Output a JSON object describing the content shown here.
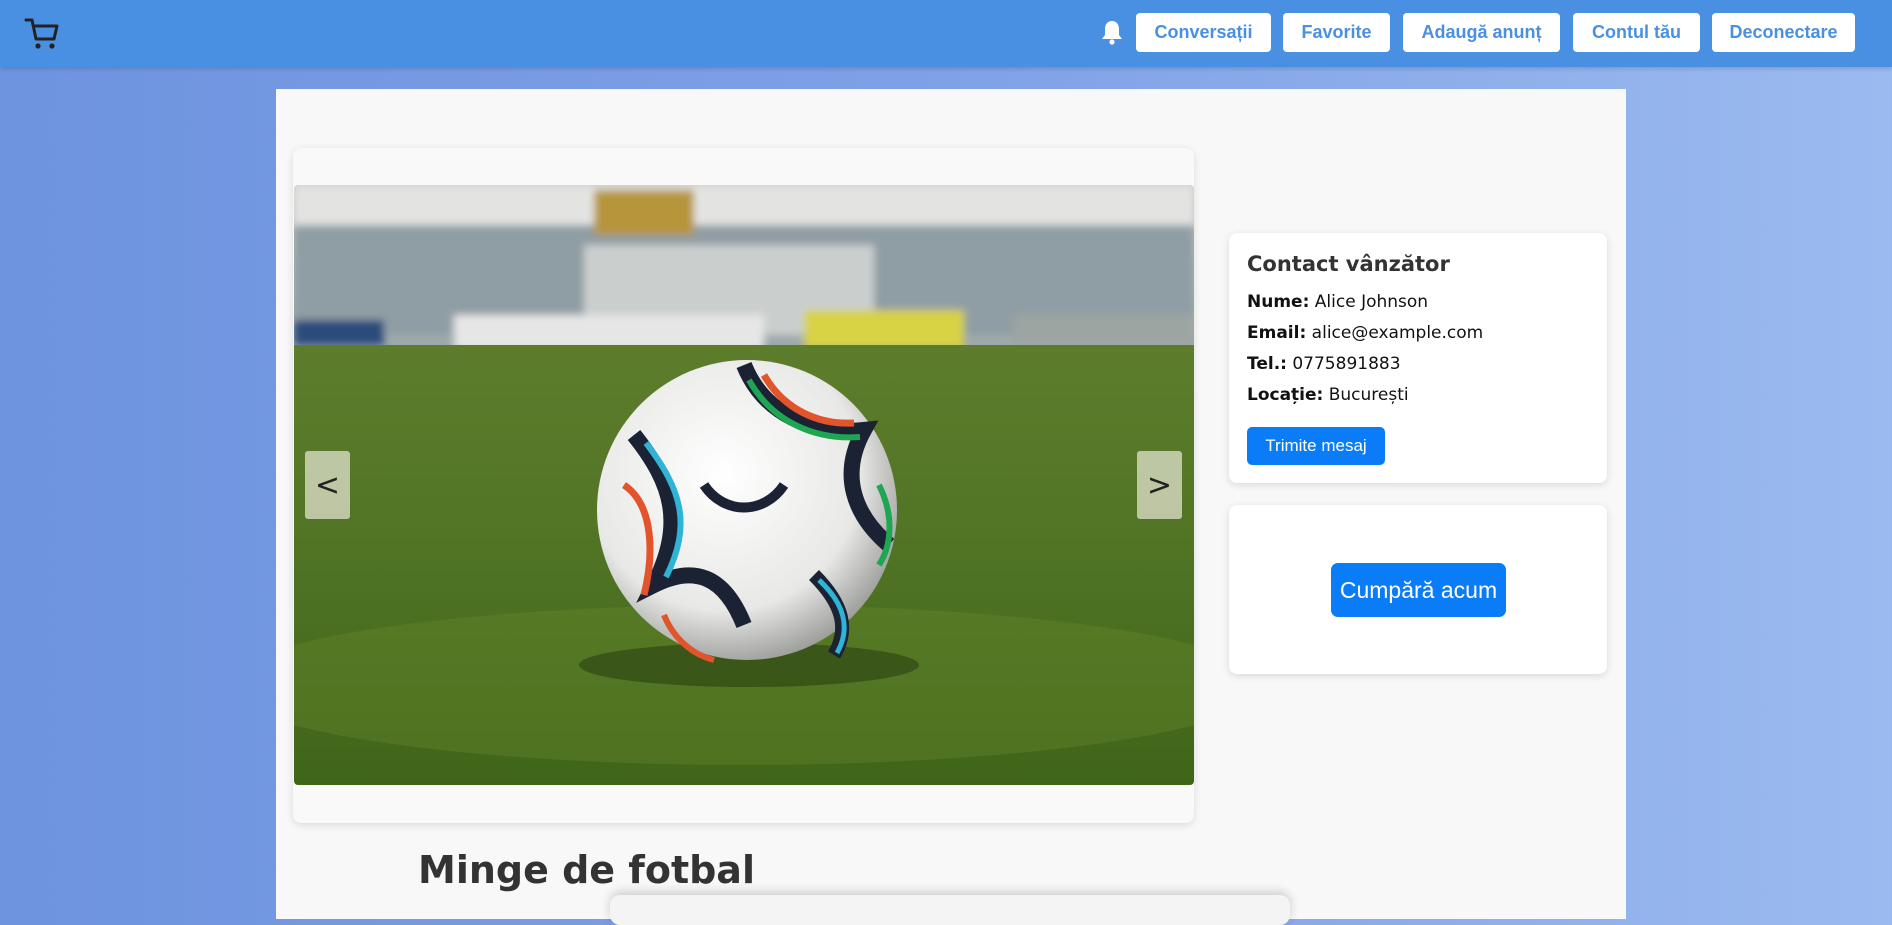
{
  "header": {
    "nav": [
      {
        "label": "Conversații"
      },
      {
        "label": "Favorite"
      },
      {
        "label": "Adaugă anunț"
      },
      {
        "label": "Contul tău"
      },
      {
        "label": "Deconectare"
      }
    ],
    "icons": {
      "cart": "shopping-cart-icon",
      "bell": "notification-bell-icon"
    },
    "colors": {
      "bar": "#4a90e2",
      "button_bg": "#ffffff",
      "button_text": "#4a90e2"
    }
  },
  "carousel": {
    "prev_label": "<",
    "next_label": ">"
  },
  "contact": {
    "title": "Contact vânzător",
    "name_label": "Nume:",
    "name": "Alice Johnson",
    "email_label": "Email:",
    "email": "alice@example.com",
    "phone_label": "Tel.:",
    "phone": "0775891883",
    "location_label": "Locație:",
    "location": "București",
    "message_button": "Trimite mesaj"
  },
  "purchase": {
    "buy_button": "Cumpără acum",
    "accent": "#0a7cf7"
  },
  "listing": {
    "title": "Minge de fotbal"
  }
}
